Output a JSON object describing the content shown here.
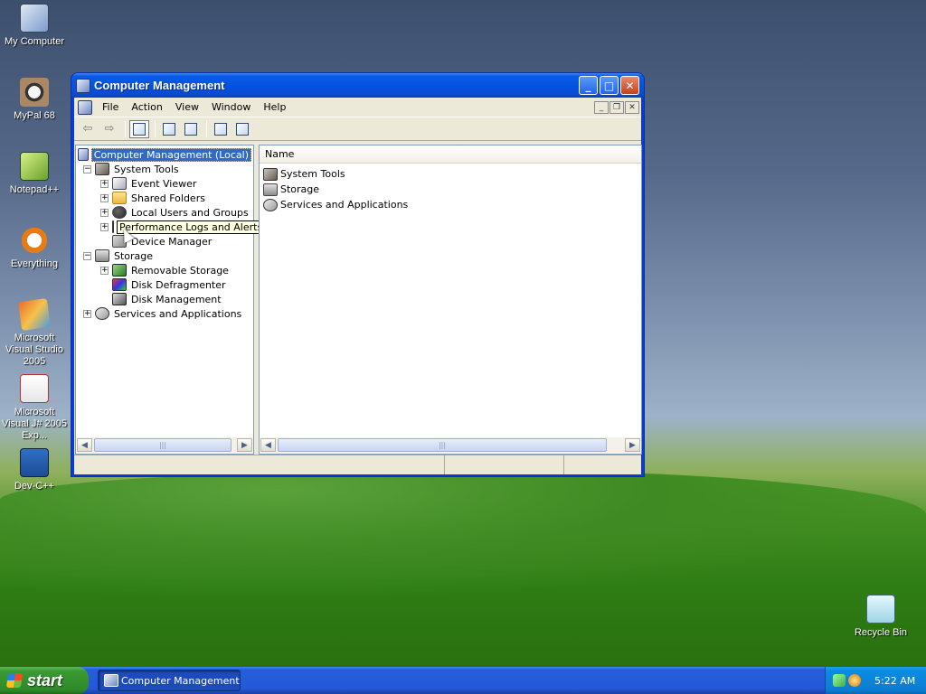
{
  "desktop": {
    "icons": [
      {
        "label": "My Computer",
        "icon": "my-computer-icon"
      },
      {
        "label": "MyPal 68",
        "icon": "mypal-icon"
      },
      {
        "label": "Notepad++",
        "icon": "notepad-plus-plus-icon"
      },
      {
        "label": "Everything",
        "icon": "everything-search-icon"
      },
      {
        "label": "Microsoft Visual Studio 2005",
        "icon": "visual-studio-icon"
      },
      {
        "label": "Microsoft Visual J# 2005 Exp...",
        "icon": "visual-jsharp-icon"
      },
      {
        "label": "Dev-C++",
        "icon": "dev-cpp-icon"
      },
      {
        "label": "Recycle Bin",
        "icon": "recycle-bin-icon"
      }
    ]
  },
  "window": {
    "title": "Computer Management",
    "menu": [
      "File",
      "Action",
      "View",
      "Window",
      "Help"
    ],
    "tree": {
      "root": "Computer Management (Local)",
      "system_tools": "System Tools",
      "event_viewer": "Event Viewer",
      "shared_folders": "Shared Folders",
      "local_users": "Local Users and Groups",
      "performance_logs": "Performance Logs and Alerts",
      "device_manager": "Device Manager",
      "storage": "Storage",
      "removable_storage": "Removable Storage",
      "disk_defragmenter": "Disk Defragmenter",
      "disk_management": "Disk Management",
      "services_apps": "Services and Applications"
    },
    "list": {
      "column_name": "Name",
      "items": [
        "System Tools",
        "Storage",
        "Services and Applications"
      ]
    }
  },
  "taskbar": {
    "start_label": "start",
    "task_label": "Computer Management",
    "clock": "5:22 AM"
  }
}
